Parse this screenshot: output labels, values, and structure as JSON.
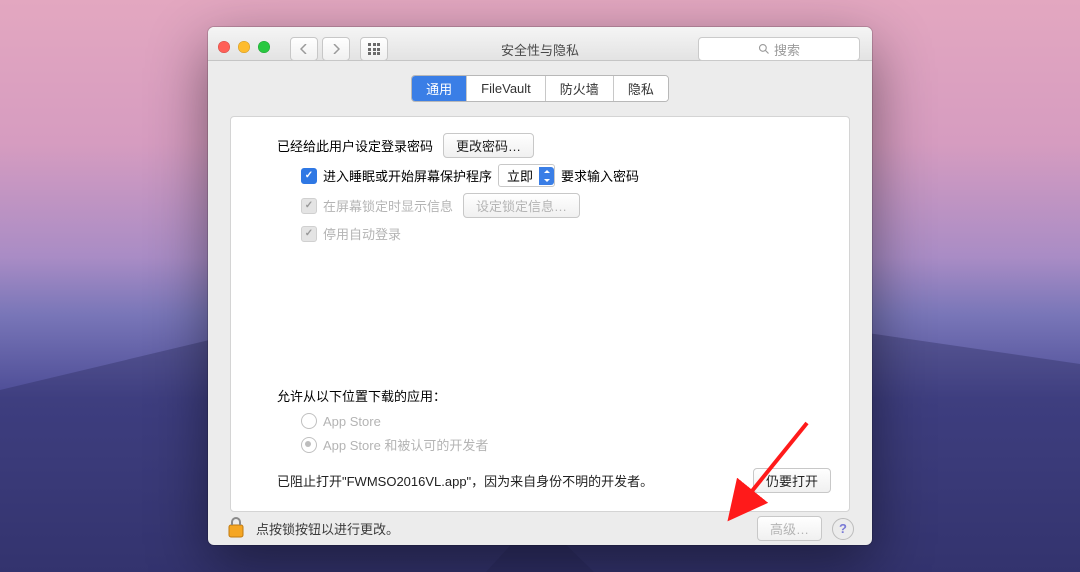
{
  "window": {
    "title": "安全性与隐私",
    "search_placeholder": "搜索"
  },
  "tabs": [
    {
      "label": "通用",
      "active": true
    },
    {
      "label": "FileVault",
      "active": false
    },
    {
      "label": "防火墙",
      "active": false
    },
    {
      "label": "隐私",
      "active": false
    }
  ],
  "general": {
    "password_set_label": "已经给此用户设定登录密码",
    "change_password_btn": "更改密码…",
    "require_password": {
      "checked": true,
      "prefix": "进入睡眠或开始屏幕保护程序",
      "select_value": "立即",
      "suffix": "要求输入密码"
    },
    "show_message": {
      "checked": true,
      "enabled": false,
      "label": "在屏幕锁定时显示信息",
      "button": "设定锁定信息…"
    },
    "disable_auto_login": {
      "checked": true,
      "enabled": false,
      "label": "停用自动登录"
    },
    "allow_from_label": "允许从以下位置下载的应用：",
    "radio_options": [
      {
        "label": "App Store",
        "selected": false
      },
      {
        "label": "App Store 和被认可的开发者",
        "selected": true
      }
    ],
    "blocked_message": "已阻止打开\"FWMSO2016VL.app\"，因为来自身份不明的开发者。",
    "open_anyway_btn": "仍要打开"
  },
  "footer": {
    "lock_text": "点按锁按钮以进行更改。",
    "advanced_btn": "高级…"
  }
}
